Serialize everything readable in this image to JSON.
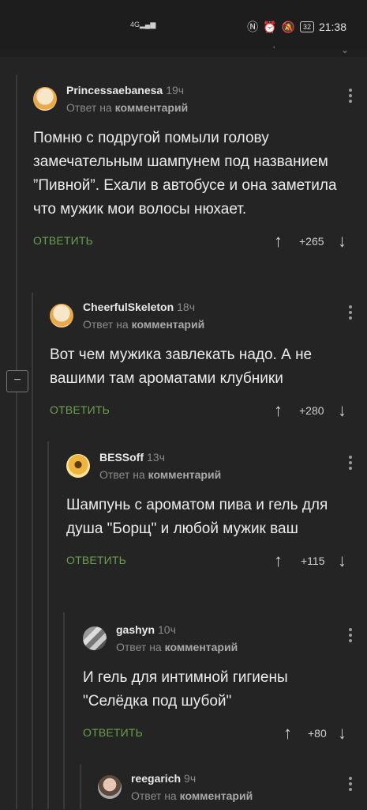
{
  "status_bar": {
    "signal": "4G",
    "battery": "32",
    "time": "21:38"
  },
  "collapse_symbol": "−",
  "comments": [
    {
      "author": "Princessaebanesa",
      "time": "19ч",
      "reply_prefix": "Ответ на",
      "reply_target": "комментарий",
      "text": "Помню с подругой помыли голову замечательным шампунем под названием ”Пивной”. Ехали в автобусе и она заметила что мужик мои волосы нюхает.",
      "reply_label": "ОТВЕТИТЬ",
      "score": "+265",
      "avatar": "avatar-cat-icon"
    },
    {
      "author": "CheerfulSkeleton",
      "time": "18ч",
      "reply_prefix": "Ответ на",
      "reply_target": "комментарий",
      "text": "Вот чем мужика завлекать надо. А не вашими там ароматами клубники",
      "reply_label": "ОТВЕТИТЬ",
      "score": "+280",
      "avatar": "avatar-cat-icon"
    },
    {
      "author": "BESSoff",
      "time": "13ч",
      "reply_prefix": "Ответ на",
      "reply_target": "комментарий",
      "text": "Шампунь с ароматом пива и гель для душа \"Борщ\" и любой мужик ваш",
      "reply_label": "ОТВЕТИТЬ",
      "score": "+115",
      "avatar": "avatar-flower-icon"
    },
    {
      "author": "gashyn",
      "time": "10ч",
      "reply_prefix": "Ответ на",
      "reply_target": "комментарий",
      "text": "И гель для интимной гигиены \"Селёдка под шубой\"",
      "reply_label": "ОТВЕТИТЬ",
      "score": "+80",
      "avatar": "avatar-abstract-icon"
    },
    {
      "author": "reegarich",
      "time": "9ч",
      "reply_prefix": "Ответ на",
      "reply_target": "комментарий",
      "avatar": "avatar-photo-icon"
    }
  ]
}
